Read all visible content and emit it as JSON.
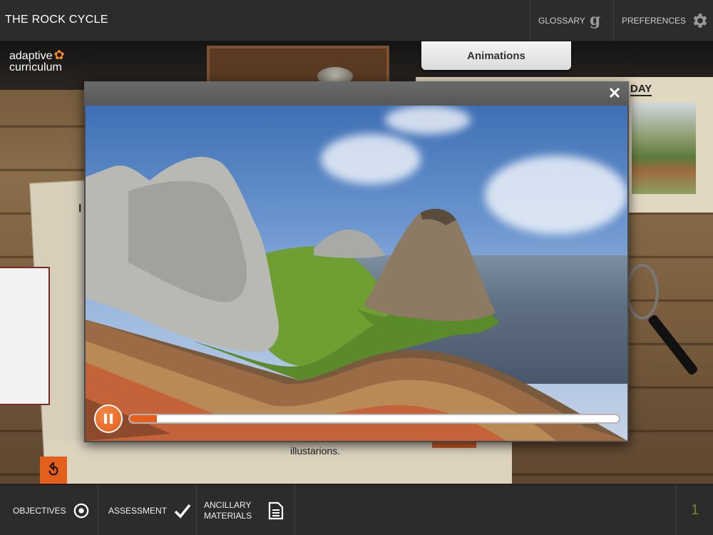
{
  "header": {
    "title": "THE ROCK CYCLE",
    "glossary_label": "GLOSSARY",
    "glossary_icon_glyph": "g",
    "preferences_label": "PREFERENCES"
  },
  "logo": {
    "line1": "adaptive",
    "line2": "curriculum"
  },
  "tab": {
    "label": "Animations"
  },
  "modal": {
    "close_glyph": "✕"
  },
  "player": {
    "state": "playing",
    "progress": 0.055
  },
  "background": {
    "poster_word": "DAY",
    "left_paper_letter": "I",
    "caption_fragment": "illustarions."
  },
  "footer": {
    "objectives_label": "OBJECTIVES",
    "assessment_label": "ASSESSMENT",
    "ancillary_label_line1": "ANCILLARY",
    "ancillary_label_line2": "MATERIALS",
    "page_number": "1"
  },
  "colors": {
    "accent_orange": "#e45e1c",
    "bar_bg": "#2c2c2c",
    "page_number": "#6f8a2a"
  }
}
